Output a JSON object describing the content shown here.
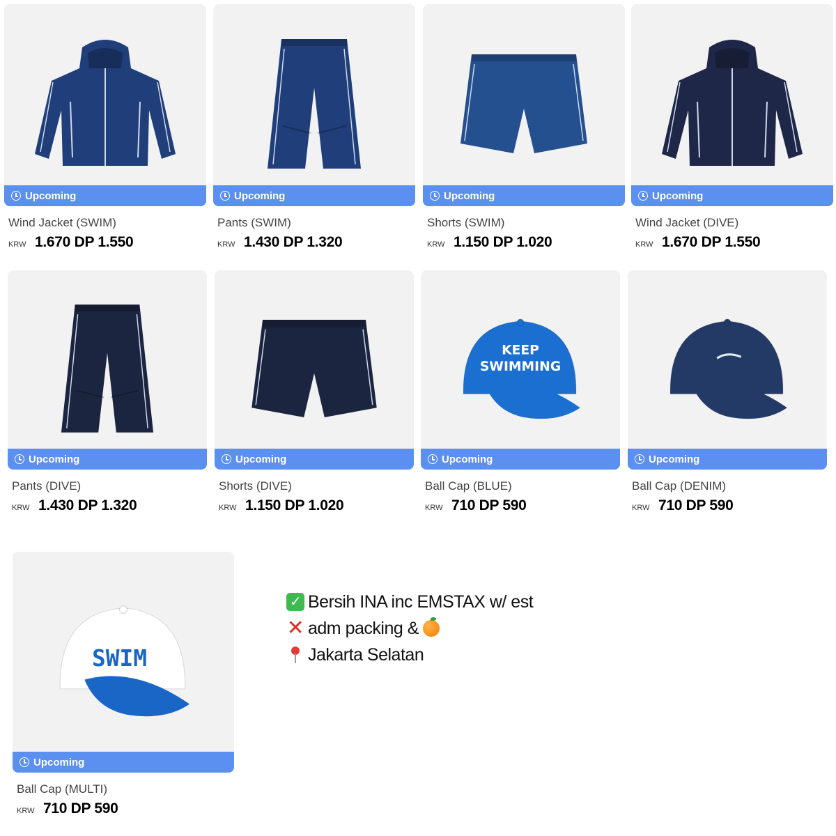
{
  "badge_label": "Upcoming",
  "currency": "KRW",
  "products": [
    {
      "name": "Wind Jacket (SWIM)",
      "price": "1.670 DP 1.550",
      "icon": "jacket-icon",
      "color": "#1f3e7a"
    },
    {
      "name": "Pants (SWIM)",
      "price": "1.430 DP 1.320",
      "icon": "pants-icon",
      "color": "#1f3e7a"
    },
    {
      "name": "Shorts (SWIM)",
      "price": "1.150 DP 1.020",
      "icon": "shorts-icon",
      "color": "#24508f"
    },
    {
      "name": "Wind Jacket (DIVE)",
      "price": "1.670 DP 1.550",
      "icon": "jacket-icon",
      "color": "#1e2747"
    },
    {
      "name": "Pants (DIVE)",
      "price": "1.430 DP 1.320",
      "icon": "pants-icon",
      "color": "#1c2540"
    },
    {
      "name": "Shorts (DIVE)",
      "price": "1.150 DP 1.020",
      "icon": "shorts-icon",
      "color": "#1c2540"
    },
    {
      "name": "Ball Cap (BLUE)",
      "price": "710 DP 590",
      "icon": "cap-icon",
      "color": "#1b6fd1",
      "cap_text": [
        "KEEP",
        "SWIMMING"
      ]
    },
    {
      "name": "Ball Cap (DENIM)",
      "price": "710 DP 590",
      "icon": "cap-icon",
      "color": "#243a66"
    },
    {
      "name": "Ball Cap (MULTI)",
      "price": "710 DP 590",
      "icon": "cap-icon",
      "color": "#ffffff",
      "brim_color": "#1a66c7",
      "cap_text": [
        "SWIM"
      ]
    }
  ],
  "notes": [
    {
      "icon": "check-mark-icon",
      "text": "Bersih INA inc EMSTAX w/ est"
    },
    {
      "icon": "cross-mark-icon",
      "text": "adm packing &",
      "trailing_icon": "orange-icon"
    },
    {
      "icon": "pin-icon",
      "text": "Jakarta Selatan"
    }
  ]
}
